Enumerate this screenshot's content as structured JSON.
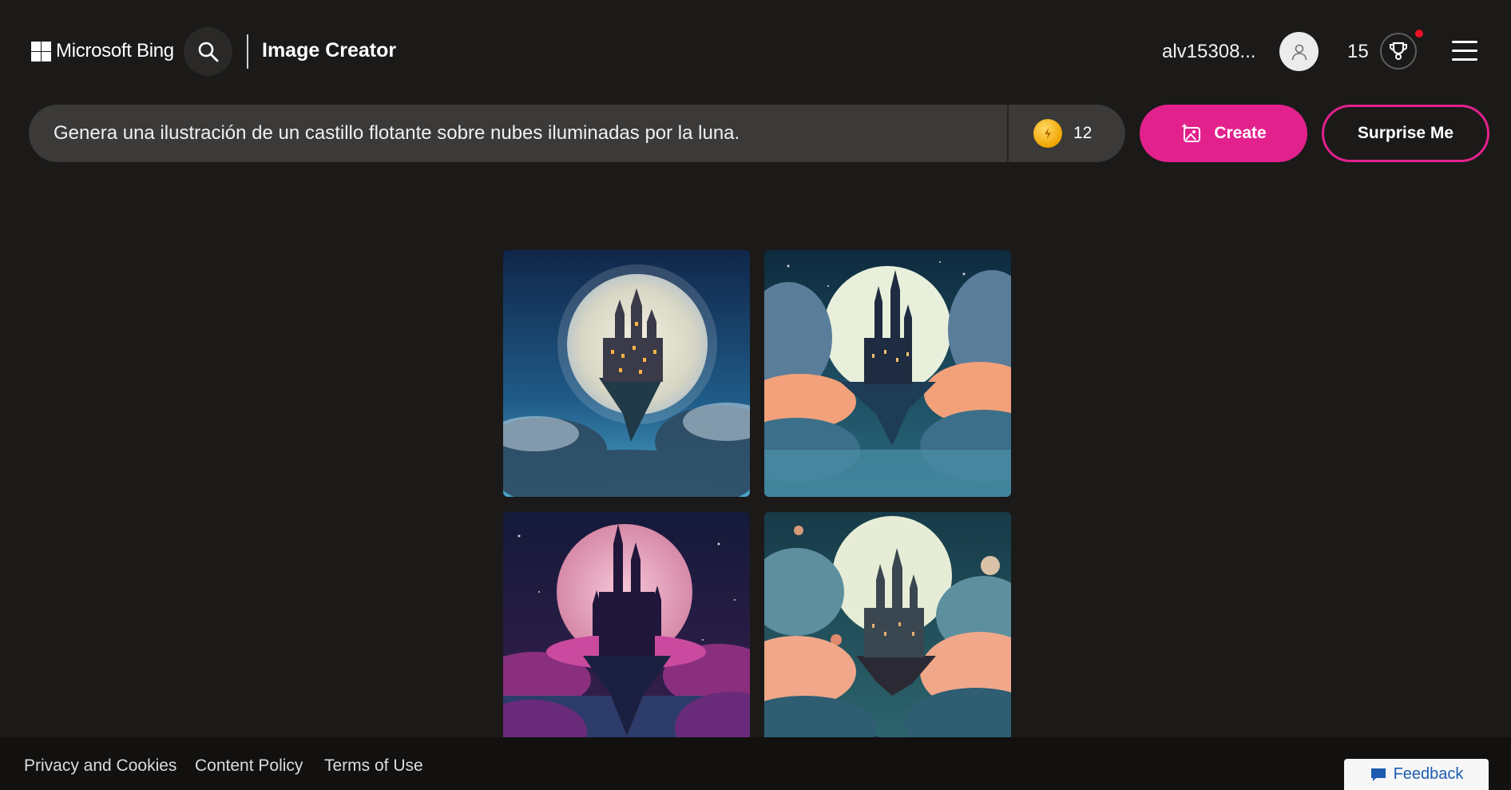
{
  "header": {
    "brand": "Microsoft Bing",
    "app_title": "Image Creator",
    "username": "alv15308...",
    "points": "15"
  },
  "prompt": {
    "value": "Genera una ilustración de un castillo flotante sobre nubes iluminadas por la luna.",
    "boosts": "12"
  },
  "buttons": {
    "create": "Create",
    "surprise": "Surprise Me"
  },
  "images": [
    {
      "name": "castle-image-1"
    },
    {
      "name": "castle-image-2"
    },
    {
      "name": "castle-image-3"
    },
    {
      "name": "castle-image-4"
    }
  ],
  "footer": {
    "privacy": "Privacy and Cookies",
    "content_policy": "Content Policy",
    "terms": "Terms of Use",
    "feedback": "Feedback"
  },
  "colors": {
    "background": "#1b1a19",
    "accent": "#e3218d",
    "input_bg": "#3b3a39"
  },
  "icons": [
    "microsoft-logo-icon",
    "search-icon",
    "user-icon",
    "trophy-icon",
    "menu-icon",
    "coin-icon",
    "image-sparkle-icon",
    "feedback-icon"
  ]
}
